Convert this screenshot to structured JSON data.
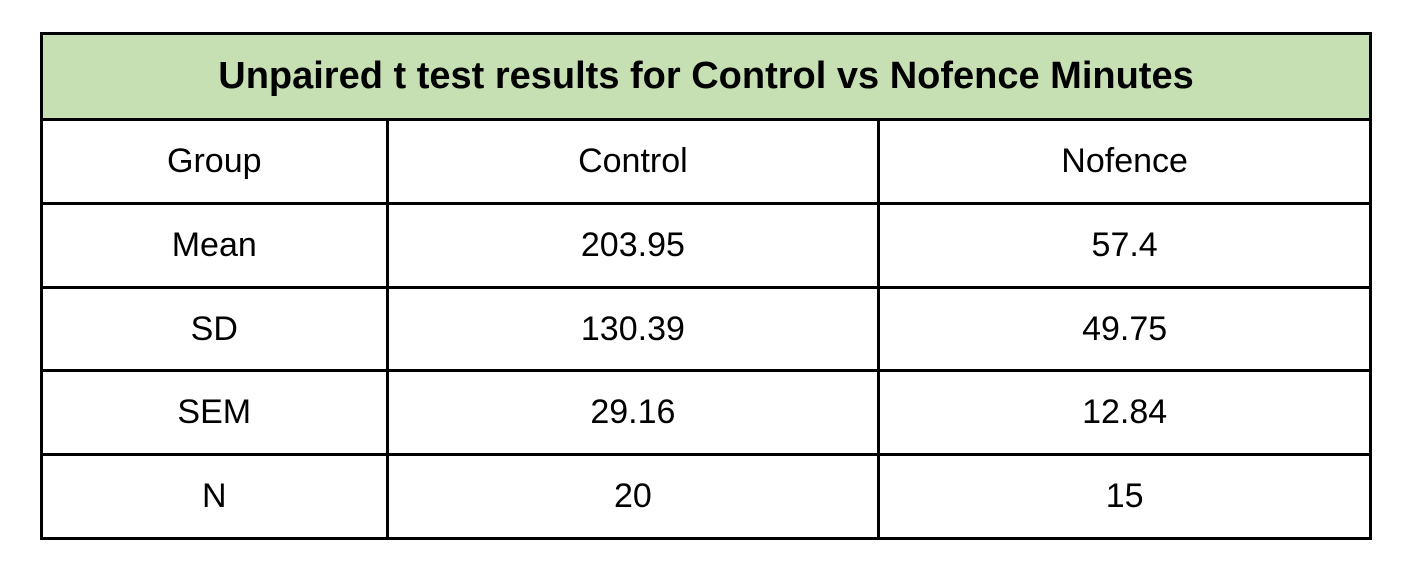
{
  "chart_data": {
    "type": "table",
    "title": "Unpaired t test results for Control vs Nofence Minutes",
    "columns": [
      "Group",
      "Control",
      "Nofence"
    ],
    "rows": [
      {
        "label": "Mean",
        "control": "203.95",
        "nofence": "57.4"
      },
      {
        "label": "SD",
        "control": "130.39",
        "nofence": "49.75"
      },
      {
        "label": "SEM",
        "control": "29.16",
        "nofence": "12.84"
      },
      {
        "label": "N",
        "control": "20",
        "nofence": "15"
      }
    ]
  }
}
